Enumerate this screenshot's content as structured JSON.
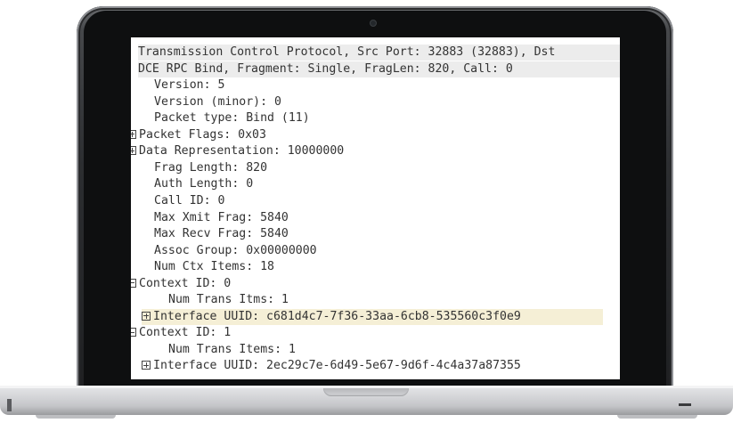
{
  "packet_details": {
    "lines": [
      {
        "text": "Transmission Control Protocol, Src Port: 32883 (32883), Dst",
        "indent": 0,
        "expander": "none",
        "style": "hdr"
      },
      {
        "text": "DCE RPC Bind, Fragment: Single, FragLen: 820, Call: 0",
        "indent": 0,
        "expander": "none",
        "style": "hdr"
      },
      {
        "text": "Version: 5",
        "indent": 1,
        "expander": "none",
        "style": ""
      },
      {
        "text": "Version (minor): 0",
        "indent": 1,
        "expander": "none",
        "style": ""
      },
      {
        "text": "Packet type: Bind (11)",
        "indent": 1,
        "expander": "none",
        "style": ""
      },
      {
        "text": "Packet Flags: 0x03",
        "indent": 0,
        "expander": "plus",
        "style": ""
      },
      {
        "text": "Data Representation: 10000000",
        "indent": 0,
        "expander": "plus",
        "style": ""
      },
      {
        "text": "Frag Length: 820",
        "indent": 1,
        "expander": "none",
        "style": ""
      },
      {
        "text": "Auth Length: 0",
        "indent": 1,
        "expander": "none",
        "style": ""
      },
      {
        "text": "Call ID: 0",
        "indent": 1,
        "expander": "none",
        "style": ""
      },
      {
        "text": "Max Xmit Frag: 5840",
        "indent": 1,
        "expander": "none",
        "style": ""
      },
      {
        "text": "Max Recv Frag: 5840",
        "indent": 1,
        "expander": "none",
        "style": ""
      },
      {
        "text": "Assoc Group: 0x00000000",
        "indent": 1,
        "expander": "none",
        "style": ""
      },
      {
        "text": "Num Ctx Items: 18",
        "indent": 1,
        "expander": "none",
        "style": ""
      },
      {
        "text": "Context ID: 0",
        "indent": 0,
        "expander": "minus",
        "style": ""
      },
      {
        "text": "Num Trans Itms: 1",
        "indent": 2,
        "expander": "none",
        "style": ""
      },
      {
        "text": "Interface UUID: c681d4c7-7f36-33aa-6cb8-535560c3f0e9",
        "indent": 1,
        "expander": "plus",
        "style": "sel"
      },
      {
        "text": "Context ID: 1",
        "indent": 0,
        "expander": "minus",
        "style": ""
      },
      {
        "text": "Num Trans Items: 1",
        "indent": 2,
        "expander": "none",
        "style": ""
      },
      {
        "text": "Interface UUID: 2ec29c7e-6d49-5e67-9d6f-4c4a37a87355",
        "indent": 1,
        "expander": "plus",
        "style": ""
      }
    ]
  },
  "colors": {
    "text": "#333333",
    "header_bg": "#ececec",
    "selected_bg": "#f5efd6",
    "laptop_frame": "#1e1f21",
    "laptop_base": "#d6d7da"
  }
}
